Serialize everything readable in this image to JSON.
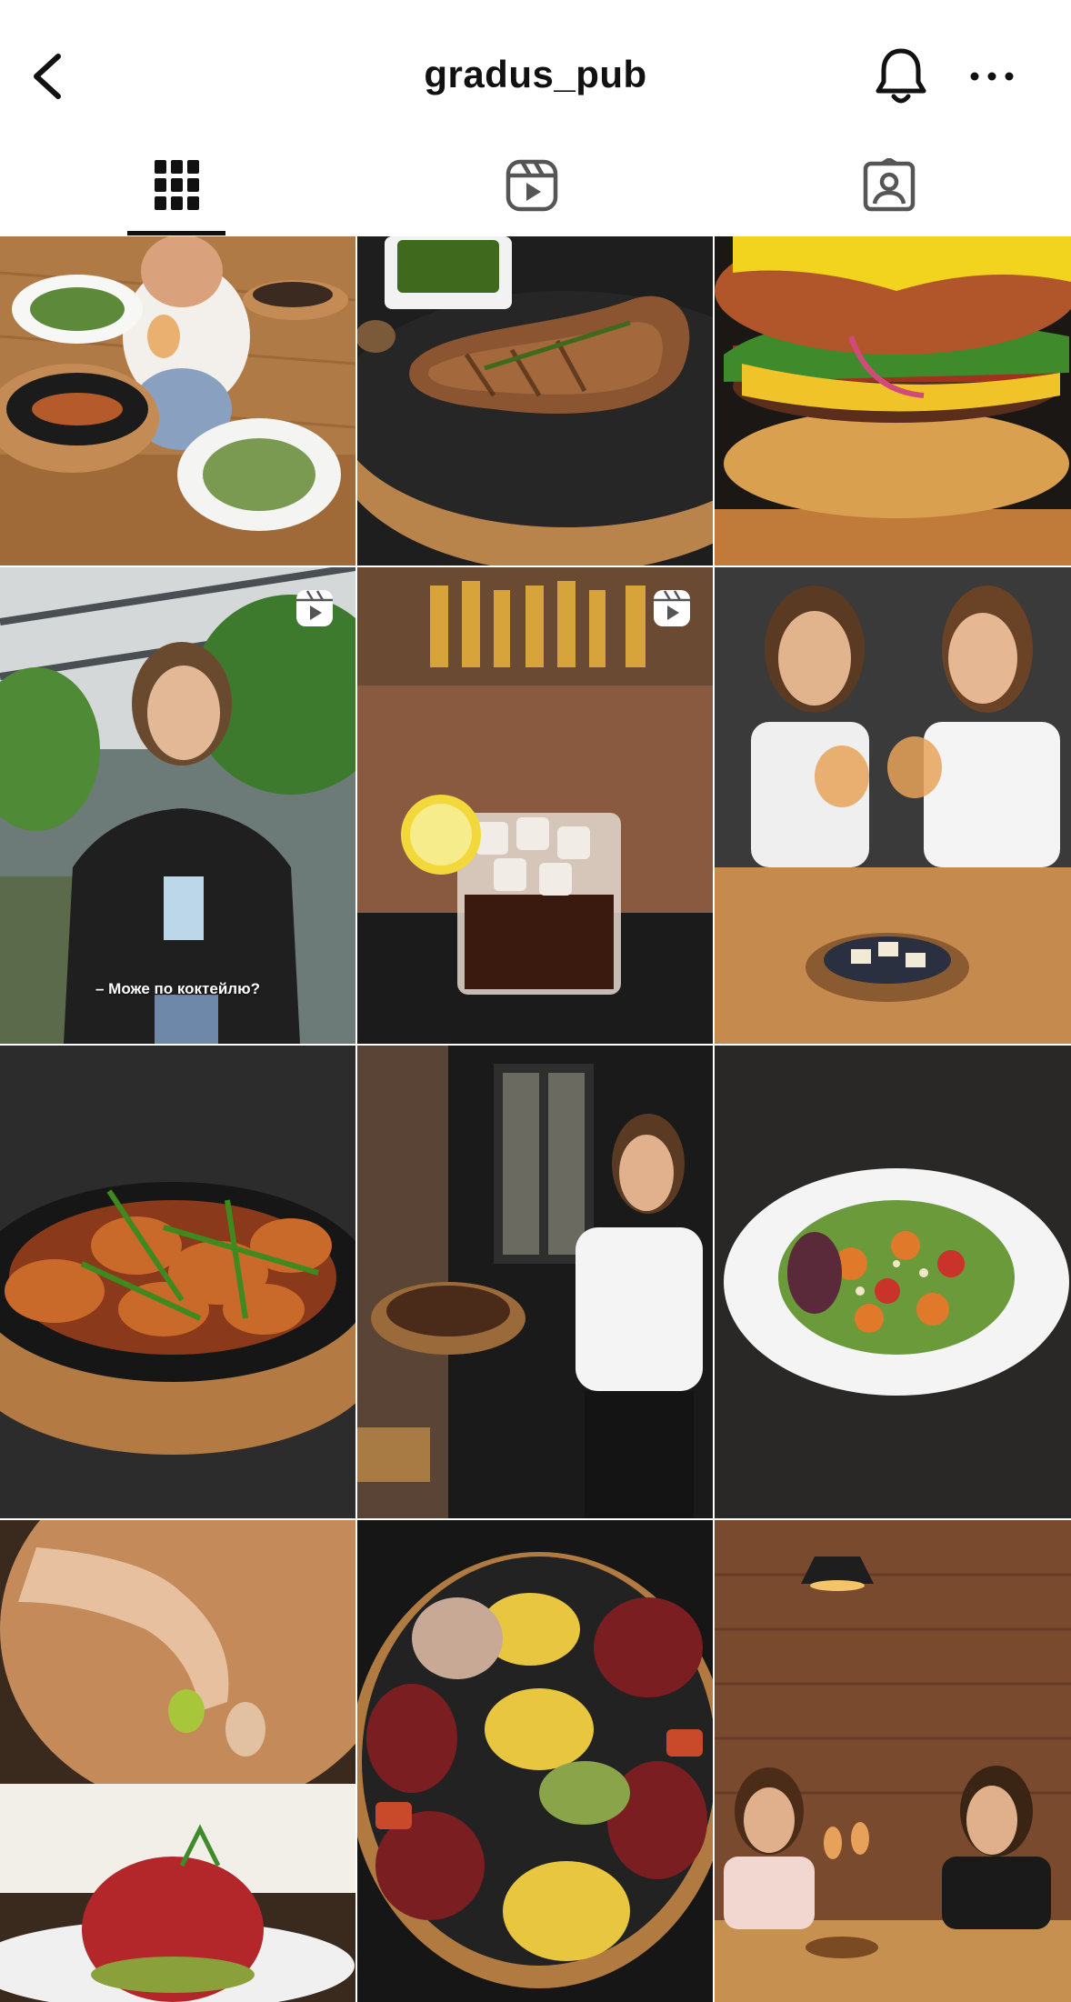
{
  "header": {
    "username": "gradus_pub",
    "back_icon": "chevron-left-icon",
    "bell_icon": "bell-icon",
    "more_icon": "more-horizontal-icon"
  },
  "tabs": [
    {
      "name": "posts",
      "icon": "grid-icon",
      "active": true
    },
    {
      "name": "reels",
      "icon": "reels-icon",
      "active": false
    },
    {
      "name": "tagged",
      "icon": "tagged-icon",
      "active": false
    }
  ],
  "posts": [
    {
      "subject": "woman with salads",
      "type": "photo"
    },
    {
      "subject": "grilled pork chop",
      "type": "photo"
    },
    {
      "subject": "cheeseburger",
      "type": "photo"
    },
    {
      "subject": "woman in leather jacket",
      "type": "reel",
      "caption": "– Може по коктейлю?"
    },
    {
      "subject": "cola with ice and lemon",
      "type": "reel"
    },
    {
      "subject": "two women toasting wine",
      "type": "photo"
    },
    {
      "subject": "potato wedges in pan",
      "type": "photo"
    },
    {
      "subject": "waitress holding platter",
      "type": "photo"
    },
    {
      "subject": "salad plate",
      "type": "photo"
    },
    {
      "subject": "lime squeeze on tartare",
      "type": "photo"
    },
    {
      "subject": "snack platter",
      "type": "photo"
    },
    {
      "subject": "two women at brick wall",
      "type": "photo"
    }
  ]
}
